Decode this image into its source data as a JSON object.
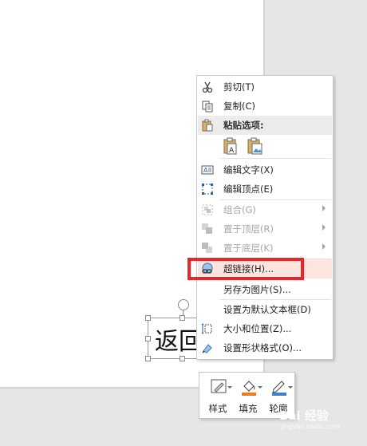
{
  "textbox": {
    "text": "返回"
  },
  "menu": {
    "items": [
      {
        "label": "剪切(T)",
        "icon": "scissors-icon",
        "disabled": false
      },
      {
        "label": "复制(C)",
        "icon": "copy-icon",
        "disabled": false
      },
      {
        "label": "粘贴选项:",
        "icon": "paste-icon",
        "header": true
      },
      {
        "label": "编辑文字(X)",
        "icon": "edit-text-icon",
        "disabled": false
      },
      {
        "label": "编辑顶点(E)",
        "icon": "edit-points-icon",
        "disabled": false
      },
      {
        "label": "组合(G)",
        "icon": "group-icon",
        "disabled": true,
        "submenu": true
      },
      {
        "label": "置于顶层(R)",
        "icon": "bring-front-icon",
        "disabled": true,
        "submenu": true
      },
      {
        "label": "置于底层(K)",
        "icon": "send-back-icon",
        "disabled": true,
        "submenu": true
      },
      {
        "label": "超链接(H)...",
        "icon": "hyperlink-icon",
        "disabled": false,
        "highlighted": true
      },
      {
        "label": "另存为图片(S)...",
        "icon": "",
        "disabled": false
      },
      {
        "label": "设置为默认文本框(D)",
        "icon": "",
        "disabled": false
      },
      {
        "label": "大小和位置(Z)...",
        "icon": "size-position-icon",
        "disabled": false
      },
      {
        "label": "设置形状格式(O)...",
        "icon": "format-shape-icon",
        "disabled": false
      }
    ]
  },
  "minibar": {
    "style_label": "样式",
    "fill_label": "填充",
    "outline_label": "轮廓"
  },
  "colors": {
    "highlight": "#e8262a",
    "fill": "#f07b1d",
    "outline": "#3f7fd1"
  },
  "watermark": {
    "text": "Bai 经验",
    "sub": "jingyan.baidu.com"
  }
}
